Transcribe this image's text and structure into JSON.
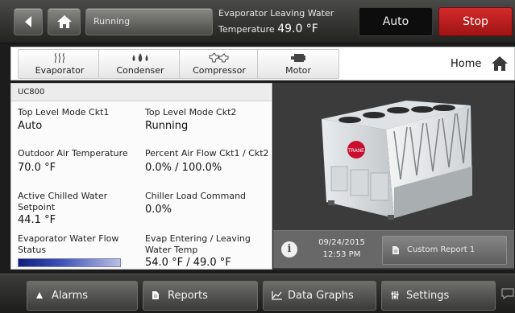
{
  "header": {
    "status_label": "Running",
    "evap_line1": "Evaporator Leaving Water",
    "evap_line2_prefix": "Temperature",
    "evap_value": "49.0 °F",
    "auto_label": "Auto",
    "stop_label": "Stop",
    "stop_color": "#c41f1f"
  },
  "tabs": [
    {
      "label": "Evaporator",
      "icon": "evaporator-icon"
    },
    {
      "label": "Condenser",
      "icon": "condenser-icon"
    },
    {
      "label": "Compressor",
      "icon": "compressor-icon"
    },
    {
      "label": "Motor",
      "icon": "motor-icon"
    }
  ],
  "home_label": "Home",
  "panel": {
    "title": "UC800",
    "cells": [
      {
        "label": "Top Level Mode Ckt1",
        "value": "Auto"
      },
      {
        "label": "Top Level Mode Ckt2",
        "value": "Running"
      },
      {
        "label": "Outdoor Air Temperature",
        "value": "70.0 °F"
      },
      {
        "label": "Percent Air Flow Ckt1 / Ckt2",
        "value": "0.0% / 100.0%"
      },
      {
        "label_line1": "Active Chilled Water",
        "label_line2": "Setpoint",
        "value": "44.1 °F"
      },
      {
        "label": "Chiller Load Command",
        "value": "0.0%"
      },
      {
        "label_line1": "Evaporator Water Flow",
        "label_line2": "Status"
      },
      {
        "label_line1": "Evap Entering / Leaving",
        "label_line2": "Water Temp",
        "value": "54.0 °F / 49.0 °F"
      }
    ]
  },
  "info": {
    "date": "09/24/2015",
    "time": "12:53 PM",
    "custom_report_label": "Custom Report 1"
  },
  "nav": {
    "alarms": "Alarms",
    "reports": "Reports",
    "data_graphs": "Data Graphs",
    "settings": "Settings"
  }
}
